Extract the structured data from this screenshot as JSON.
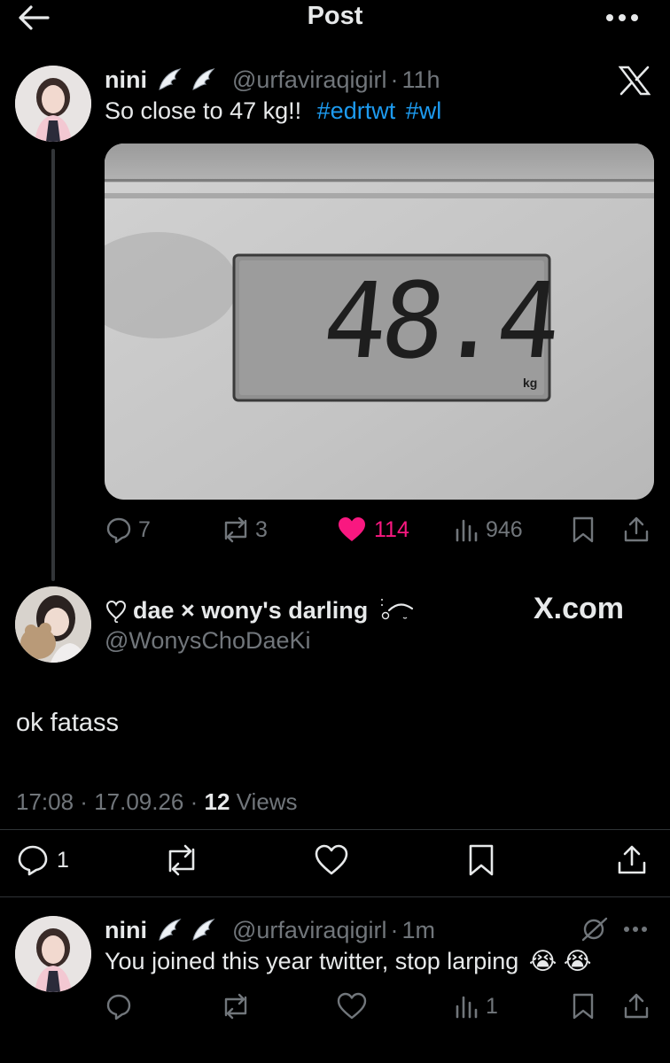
{
  "header": {
    "title": "Post"
  },
  "original_post": {
    "author_name": "nini",
    "handle": "@urfaviraqigirl",
    "sep": "·",
    "time": "11h",
    "text_plain": "So close to 47 kg!!",
    "hashtags": [
      "#edrtwt",
      "#wl"
    ],
    "image": {
      "display_value": "48.4",
      "unit": "kg"
    },
    "actions": {
      "replies": "7",
      "reposts": "3",
      "likes": "114",
      "views": "946"
    },
    "platform_icon": "x-logo-icon"
  },
  "reply": {
    "author_name": "dae × wony's darling",
    "handle": "@WonysChoDaeKi",
    "source_label": "X.com",
    "text": "ok fatass",
    "meta": {
      "time": "17:08",
      "date": "17.09.26",
      "views_count": "12",
      "views_label": "Views"
    },
    "actions": {
      "replies": "1"
    }
  },
  "nested_reply": {
    "author_name": "nini",
    "handle": "@urfaviraqigirl",
    "sep": "·",
    "time": "1m",
    "text": "You joined this year twitter, stop larping",
    "emoji": "😭 😭",
    "actions": {
      "views": "1"
    }
  },
  "colors": {
    "background": "#000000",
    "text": "#e7e9ea",
    "muted": "#71767b",
    "link": "#1d9bf0",
    "like": "#f91880"
  }
}
